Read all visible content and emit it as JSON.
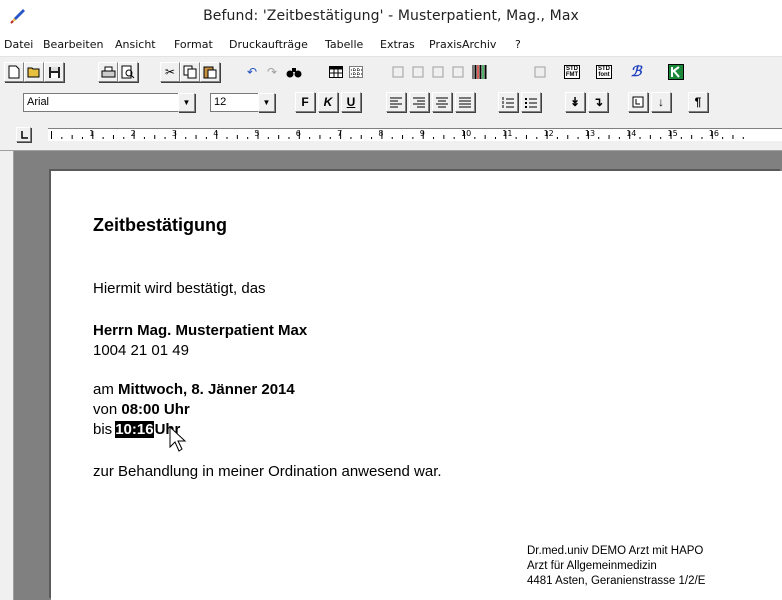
{
  "window": {
    "title": "Befund: 'Zeitbestätigung' - Musterpatient, Mag., Max"
  },
  "menu": [
    "Datei",
    "Bearbeiten",
    "Ansicht",
    "Format",
    "Druckaufträge",
    "Tabelle",
    "Extras",
    "PraxisArchiv",
    "?"
  ],
  "toolbar": {
    "font_name": "Arial",
    "font_size": "12",
    "bold_label": "F",
    "italic_label": "K",
    "underline_label": "U",
    "std_fmt_label": "STD FMT",
    "std_font_label": "STD font",
    "paragraph_mark": "¶"
  },
  "ruler": {
    "numbers": [
      "1",
      "2",
      "3",
      "4",
      "5",
      "6",
      "7",
      "8",
      "9",
      "10",
      "11",
      "12",
      "13",
      "14",
      "15",
      "16"
    ]
  },
  "document": {
    "heading": "Zeitbestätigung",
    "intro": "Hiermit wird bestätigt, das",
    "patient_name": "Herrn Mag. Musterpatient Max",
    "patient_id": "1004 21 01 49",
    "date_prefix": "am",
    "date": "Mittwoch, 8. Jänner 2014",
    "from_prefix": "von",
    "from_time": "08:00",
    "from_unit": "Uhr",
    "to_prefix": "bis",
    "to_time": "10:16",
    "to_unit": "Uhr",
    "closing": "zur Behandlung in meiner Ordination anwesend war.",
    "signature": [
      "Dr.med.univ DEMO Arzt mit HAPO",
      "Arzt für Allgemeinmedizin",
      "4481 Asten, Geranienstrasse 1/2/E"
    ]
  },
  "colors": {
    "workspace": "#808080",
    "highlight": "#000000",
    "window_bg": "#f0f0f0"
  }
}
